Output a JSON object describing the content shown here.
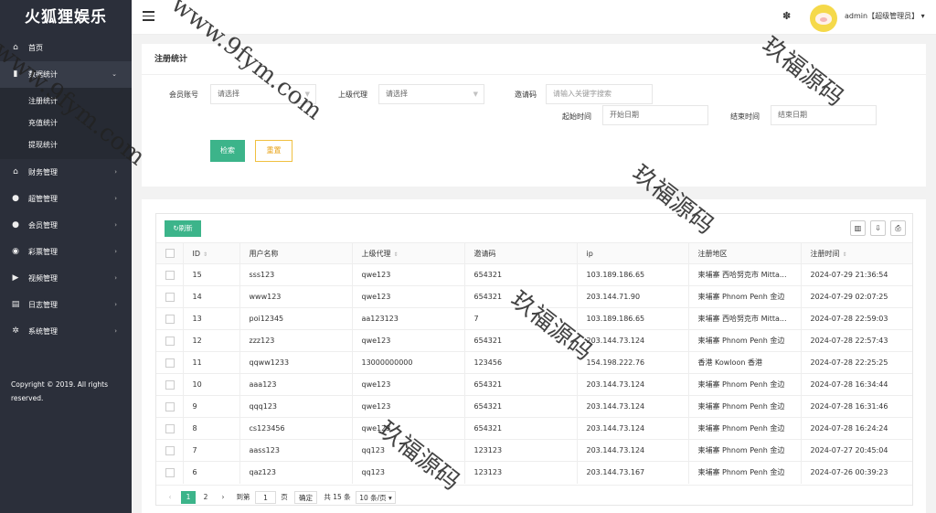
{
  "app": {
    "logo": "火狐狸娱乐"
  },
  "sidebar": {
    "items": [
      {
        "label": "首页",
        "icon": "home-icon",
        "glyph": "⌂",
        "name": "home"
      },
      {
        "label": "数据统计",
        "icon": "bar-chart-icon",
        "glyph": "▮",
        "name": "data-stats",
        "open": true,
        "children": [
          {
            "label": "注册统计"
          },
          {
            "label": "充值统计"
          },
          {
            "label": "提现统计"
          }
        ]
      },
      {
        "label": "财务管理",
        "icon": "bank-icon",
        "glyph": "⌂",
        "name": "finance"
      },
      {
        "label": "超管管理",
        "icon": "user-icon",
        "glyph": "●",
        "name": "super-admin"
      },
      {
        "label": "会员管理",
        "icon": "users-icon",
        "glyph": "●",
        "name": "members"
      },
      {
        "label": "彩票管理",
        "icon": "gamepad-icon",
        "glyph": "◉",
        "name": "lottery"
      },
      {
        "label": "视频管理",
        "icon": "video-icon",
        "glyph": "▶",
        "name": "video"
      },
      {
        "label": "日志管理",
        "icon": "log-icon",
        "glyph": "▤",
        "name": "logs"
      },
      {
        "label": "系统管理",
        "icon": "gear-icon",
        "glyph": "✲",
        "name": "system"
      }
    ],
    "copyright": "Copyright © 2019. All rights reserved."
  },
  "header": {
    "user": "admin【超级管理员】",
    "user_caret": "▾"
  },
  "filter": {
    "title": "注册统计",
    "member_label": "会员账号",
    "member_value": "请选择",
    "parent_label": "上级代理",
    "parent_value": "请选择",
    "invite_label": "邀请码",
    "invite_placeholder": "请输入关键字搜索",
    "start_label": "起始时间",
    "start_placeholder": "开始日期",
    "end_label": "结束时间",
    "end_placeholder": "结束日期",
    "search_button": "检索",
    "reset_button": "重置"
  },
  "table": {
    "refresh_button": "刷新",
    "columns": [
      "ID",
      "用户名称",
      "上级代理",
      "邀请码",
      "ip",
      "注册地区",
      "注册时间"
    ],
    "rows": [
      [
        "15",
        "sss123",
        "qwe123",
        "654321",
        "103.189.186.65",
        "柬埔寨 西哈努克市 Mitta...",
        "2024-07-29 21:36:54"
      ],
      [
        "14",
        "www123",
        "qwe123",
        "654321",
        "203.144.71.90",
        "柬埔寨 Phnom Penh 金边",
        "2024-07-29 02:07:25"
      ],
      [
        "13",
        "poi12345",
        "aa123123",
        "7",
        "103.189.186.65",
        "柬埔寨 西哈努克市 Mitta...",
        "2024-07-28 22:59:03"
      ],
      [
        "12",
        "zzz123",
        "qwe123",
        "654321",
        "203.144.73.124",
        "柬埔寨 Phnom Penh 金边",
        "2024-07-28 22:57:43"
      ],
      [
        "11",
        "qqww1233",
        "13000000000",
        "123456",
        "154.198.222.76",
        "香港 Kowloon 香港",
        "2024-07-28 22:25:25"
      ],
      [
        "10",
        "aaa123",
        "qwe123",
        "654321",
        "203.144.73.124",
        "柬埔寨 Phnom Penh 金边",
        "2024-07-28 16:34:44"
      ],
      [
        "9",
        "qqq123",
        "qwe123",
        "654321",
        "203.144.73.124",
        "柬埔寨 Phnom Penh 金边",
        "2024-07-28 16:31:46"
      ],
      [
        "8",
        "cs123456",
        "qwe123",
        "654321",
        "203.144.73.124",
        "柬埔寨 Phnom Penh 金边",
        "2024-07-28 16:24:24"
      ],
      [
        "7",
        "aass123",
        "qq123",
        "123123",
        "203.144.73.124",
        "柬埔寨 Phnom Penh 金边",
        "2024-07-27 20:45:04"
      ],
      [
        "6",
        "qaz123",
        "qq123",
        "123123",
        "203.144.73.167",
        "柬埔寨 Phnom Penh 金边",
        "2024-07-26 00:39:23"
      ]
    ]
  },
  "pagination": {
    "prev": "‹",
    "pages": [
      "1",
      "2"
    ],
    "next": "›",
    "goto_label": "到第",
    "goto_value": "1",
    "page_unit": "页",
    "confirm": "确定",
    "total": "共 15 条",
    "page_size": "10 条/页"
  },
  "watermark": {
    "site": "www.9fym.com",
    "cn": "玖福源码"
  }
}
